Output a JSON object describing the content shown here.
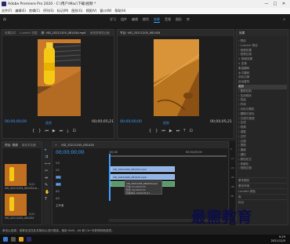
{
  "window": {
    "title": "Adobe Premiere Pro 2020 - C:\\用户\\Mac\\下载\\视频 *",
    "minimize": "—",
    "maximize": "□",
    "close": "✕"
  },
  "menu": [
    "文件(F)",
    "编辑(E)",
    "剪辑(C)",
    "序列(S)",
    "标记(M)",
    "图形(G)",
    "视图(V)",
    "窗口(W)",
    "帮助(H)"
  ],
  "workspace": {
    "tabs": [
      "学习",
      "组件",
      "编辑",
      "颜色",
      "效果",
      "音频",
      "图形",
      "库"
    ],
    "active": "效果"
  },
  "source": {
    "tabs": [
      "效果控件",
      "Lumetri 范围",
      "源: VID_20211205_081434.mp4",
      "音频剪辑混合器"
    ],
    "timecode": "00;00;00;00",
    "fit": "适合",
    "duration": "00;00;05;21"
  },
  "program": {
    "tabs": [
      "节目: VID_20211205_081434"
    ],
    "timecode": "00;00;00;00",
    "fit": "适合",
    "duration": "00;00;05;21"
  },
  "effects": {
    "title": "效果",
    "tree": [
      "› 预设",
      "› Lumetri 预设",
      "› 音频效果",
      "› 音频过渡",
      "∨ 视频效果",
      "∨ 变换",
      "   垂直翻转",
      "   水平翻转",
      "   羽化边缘",
      "   自动重构",
      "   裁剪",
      "› 图像控制",
      "› 实用程序",
      "› 扭曲",
      "› 时间",
      "› 杂色与颗粒",
      "› 模糊与锐化",
      "› 沉浸式视频",
      "› 生成",
      "› 视频",
      "› 调整",
      "› 过时",
      "› 过渡",
      "› 透视",
      "› 通道",
      "› 键控",
      "› 颜色校正",
      "› 风格化",
      "› 视频过渡"
    ],
    "bottom": [
      "基本图形",
      "基本声音",
      "Lumetri 颜色",
      "库",
      "标记"
    ]
  },
  "project": {
    "tabs": [
      "项目: 视频",
      "媒体浏览器"
    ],
    "items": [
      {
        "name": "VID_20211205_081434.m...",
        "duration": "5;21"
      },
      {
        "name": "VID_20211205_081434",
        "duration": "5;21"
      }
    ]
  },
  "timeline": {
    "tab": "VID_20211205_081434",
    "timecode": "00;00;00;00",
    "ruler": [
      ";00;00",
      "00;00;05;00"
    ],
    "tracks": [
      "V3",
      "V2",
      "V1",
      "A1",
      "A2",
      "A3"
    ],
    "clip_v2": "VID_20211205_081434.mp4",
    "clip_v1": "VID_20211205_081434.mp4",
    "tooltip": {
      "name": "VID_20211205_081434.mp4",
      "start": "开始: 00;00;00;00",
      "end": "结束: 00;00;05;20",
      "duration": "持续时间: 00;00;05;21"
    },
    "master": "主声道",
    "meter_labels": [
      "0",
      "-12",
      "-24",
      "-36",
      "-48",
      "dB"
    ]
  },
  "status": "单击以选择，或单击空白处并拖动以进行框选。使用 Shift、Alt 和 Ctrl 可获得其他选项。",
  "taskbar": {
    "time": "9:29",
    "date": "2021/12/5"
  },
  "watermark": "最需教育",
  "colors": {
    "accent": "#3fa0ff",
    "clip_video": "#8fb4e8",
    "clip_audio": "#5a9a6a",
    "watermark": "#0e0e45"
  }
}
